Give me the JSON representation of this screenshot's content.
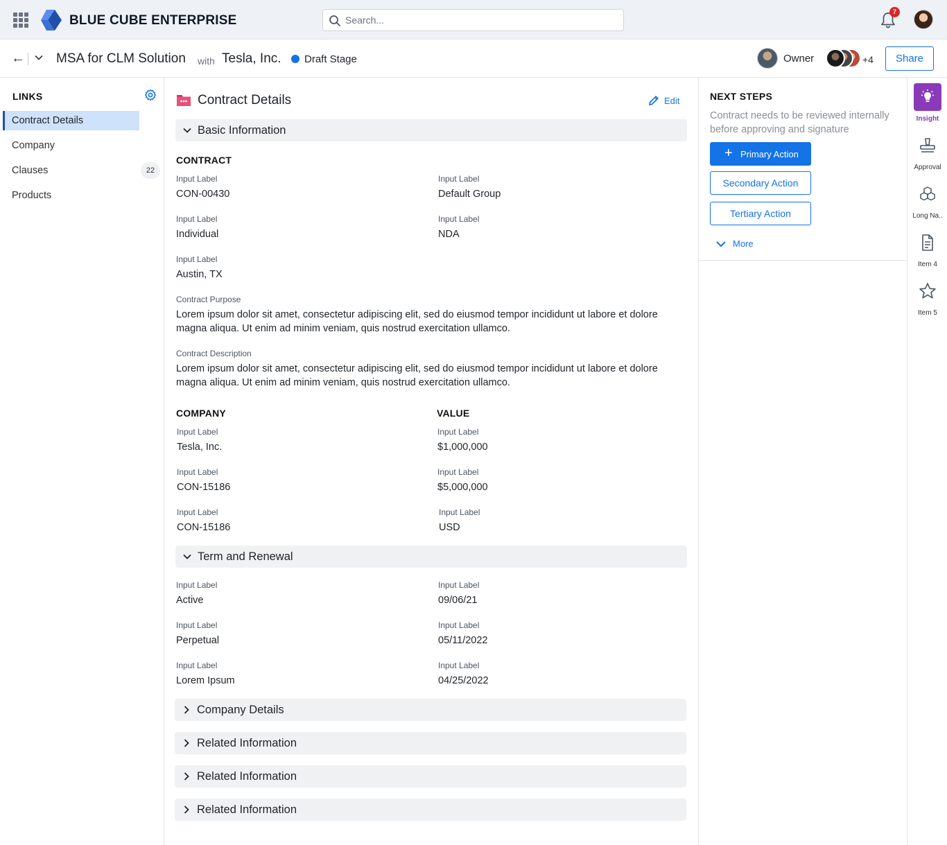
{
  "topbar": {
    "brand": "BLUE CUBE ENTERPRISE",
    "search_placeholder": "Search...",
    "notification_count": "7"
  },
  "header": {
    "title": "MSA for CLM Solution",
    "with_label": "with",
    "party": "Tesla, Inc.",
    "stage": "Draft Stage",
    "stage_color": "#1473e6",
    "owner_label": "Owner",
    "more_collaborators": "+4",
    "share_label": "Share"
  },
  "links": {
    "title": "LINKS",
    "items": [
      {
        "label": "Contract Details",
        "active": true
      },
      {
        "label": "Company"
      },
      {
        "label": "Clauses",
        "count": "22"
      },
      {
        "label": "Products"
      }
    ]
  },
  "main": {
    "title": "Contract Details",
    "edit_label": "Edit",
    "basic_info": {
      "label": "Basic Information",
      "contract_heading": "CONTRACT",
      "fields": [
        {
          "label": "Input Label",
          "value": "CON-00430"
        },
        {
          "label": "Input Label",
          "value": "Default Group"
        },
        {
          "label": "Input Label",
          "value": "Individual"
        },
        {
          "label": "Input Label",
          "value": "NDA"
        },
        {
          "label": "Input Label",
          "value": "Austin, TX"
        }
      ],
      "purpose_label": "Contract Purpose",
      "purpose_text": "Lorem ipsum dolor sit amet, consectetur adipiscing elit, sed do eiusmod tempor incididunt ut labore et dolore magna aliqua. Ut enim ad minim veniam, quis nostrud exercitation ullamco.",
      "description_label": "Contract Description",
      "description_text": "Lorem ipsum dolor sit amet, consectetur adipiscing elit, sed do eiusmod tempor incididunt ut labore et dolore magna aliqua. Ut enim ad minim veniam, quis nostrud exercitation ullamco.",
      "company_heading": "COMPANY",
      "value_heading": "VALUE",
      "company_fields": [
        {
          "label": "Input Label",
          "value": "Tesla, Inc."
        },
        {
          "label": "Input Label",
          "value": "CON-15186"
        },
        {
          "label": "Input Label",
          "value": "CON-15186"
        }
      ],
      "value_fields": [
        {
          "label": "Input Label",
          "value": "$1,000,000"
        },
        {
          "label": "Input Label",
          "value": "$5,000,000"
        },
        {
          "label": "Input Label",
          "value": "USD"
        }
      ]
    },
    "term_renewal": {
      "label": "Term and Renewal",
      "left_fields": [
        {
          "label": "Input Label",
          "value": "Active"
        },
        {
          "label": "Input Label",
          "value": "Perpetual"
        },
        {
          "label": "Input Label",
          "value": "Lorem Ipsum"
        }
      ],
      "right_fields": [
        {
          "label": "Input Label",
          "value": "09/06/21"
        },
        {
          "label": "Input Label",
          "value": "05/11/2022"
        },
        {
          "label": "Input Label",
          "value": "04/25/2022"
        }
      ]
    },
    "collapsed_sections": [
      "Company Details",
      "Related Information",
      "Related Information",
      "Related Information"
    ]
  },
  "next_steps": {
    "title": "NEXT STEPS",
    "description": "Contract needs to be reviewed internally before approving and signature",
    "primary_action": "Primary Action",
    "secondary_action": "Secondary Action",
    "tertiary_action": "Tertiary Action",
    "more_label": "More"
  },
  "rail": {
    "items": [
      {
        "label": "Insight",
        "icon": "lightbulb-icon",
        "active": true
      },
      {
        "label": "Approval",
        "icon": "stamp-icon"
      },
      {
        "label": "Long Na..",
        "icon": "cubes-icon"
      },
      {
        "label": "Item 4",
        "icon": "document-icon"
      },
      {
        "label": "Item 5",
        "icon": "star-icon"
      }
    ],
    "accent_color": "#8a3ab9"
  }
}
